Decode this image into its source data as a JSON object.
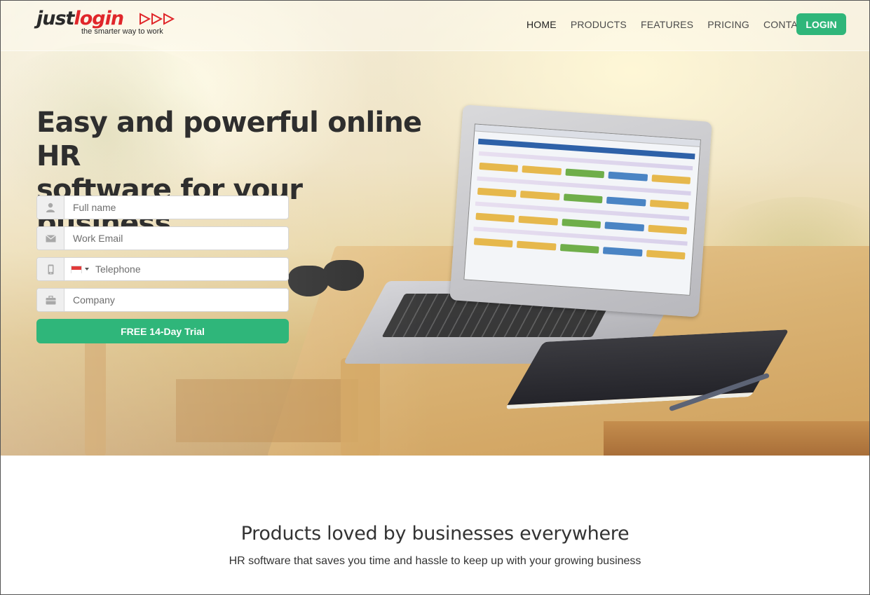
{
  "brand": {
    "logo_just": "just",
    "logo_login": "login",
    "tagline": "the smarter way to work",
    "accent_red": "#e0262a"
  },
  "nav": {
    "items": [
      {
        "label": "HOME",
        "active": true
      },
      {
        "label": "PRODUCTS",
        "active": false
      },
      {
        "label": "FEATURES",
        "active": false
      },
      {
        "label": "PRICING",
        "active": false
      },
      {
        "label": "CONTACT US",
        "active": false
      }
    ],
    "login_label": "LOGIN"
  },
  "hero": {
    "headline_line1": "Easy and powerful online HR",
    "headline_line2": "software for your business."
  },
  "form": {
    "name": {
      "placeholder": "Full name",
      "value": "",
      "icon": "user-icon"
    },
    "email": {
      "placeholder": "Work Email",
      "value": "",
      "icon": "envelope-icon"
    },
    "phone": {
      "placeholder": "Telephone",
      "value": "",
      "icon": "mobile-phone-icon",
      "country": "SG"
    },
    "company": {
      "placeholder": "Company",
      "value": "",
      "icon": "briefcase-icon"
    },
    "submit_label": "FREE 14-Day Trial"
  },
  "products": {
    "title": "Products loved by businesses everywhere",
    "subtitle": "HR software that saves you time and hassle to keep up with your growing business"
  },
  "colors": {
    "primary_green": "#2fb67a",
    "text_dark": "#2e2e2e"
  }
}
